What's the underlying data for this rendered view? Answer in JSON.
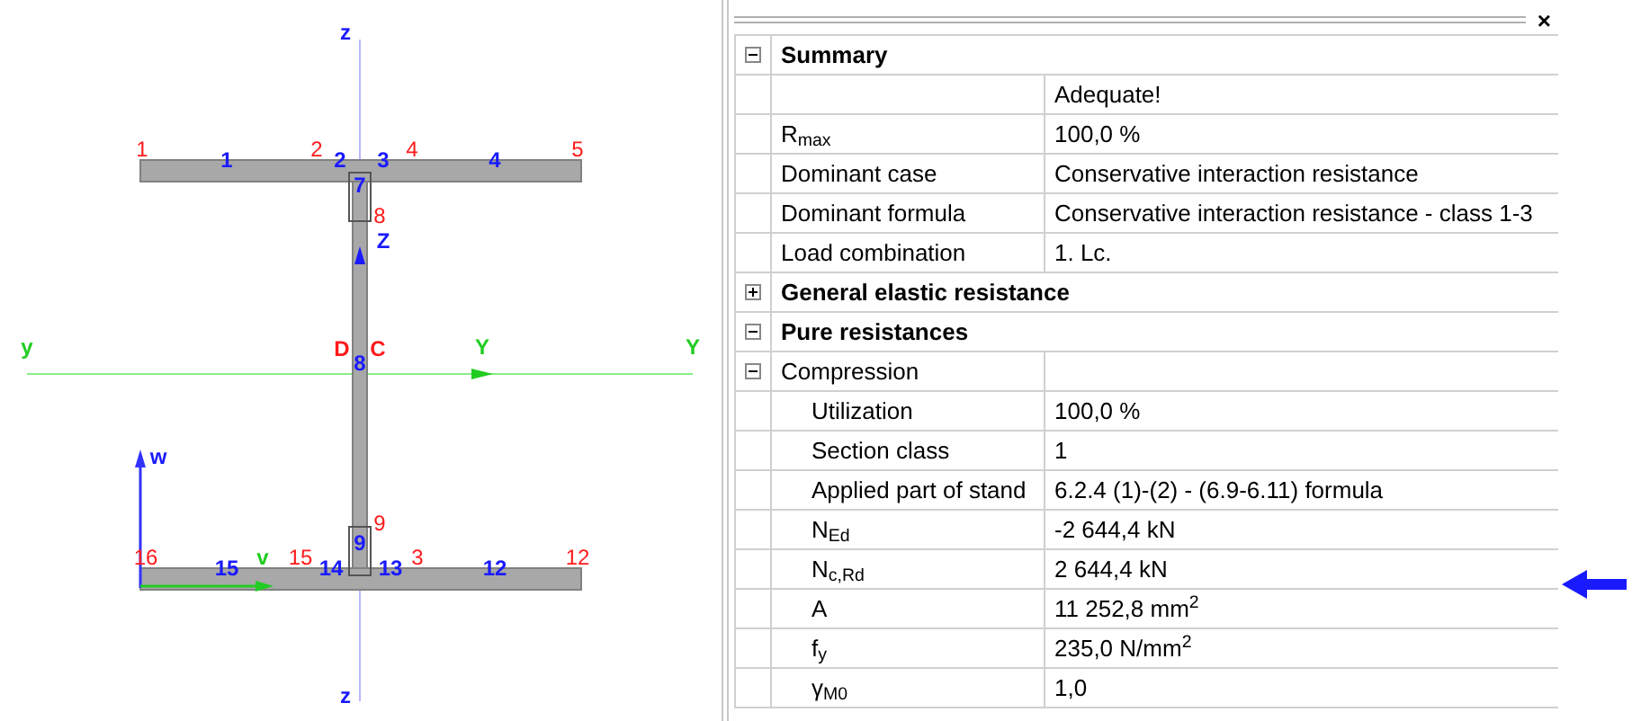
{
  "section_view": {
    "axis_labels": [
      {
        "text": "z",
        "kind": "blue"
      },
      {
        "text": "Z",
        "kind": "blue"
      },
      {
        "text": "y",
        "kind": "green"
      },
      {
        "text": "D",
        "kind": "red"
      },
      {
        "text": "C",
        "kind": "red"
      },
      {
        "text": "Y",
        "kind": "green"
      },
      {
        "text": "Y",
        "kind": "green"
      },
      {
        "text": "w",
        "kind": "blue"
      },
      {
        "text": "v",
        "kind": "green"
      },
      {
        "text": "z",
        "kind": "blue"
      }
    ],
    "node_labels": [
      "1",
      "2",
      "4",
      "5",
      "8",
      "9",
      "16",
      "15",
      "3",
      "12"
    ],
    "segment_labels": [
      "1",
      "2",
      "3",
      "4",
      "7",
      "8",
      "9",
      "15",
      "14",
      "13",
      "12"
    ]
  },
  "properties": {
    "close_glyph": "×",
    "groups": [
      {
        "title": "Summary",
        "expanded": true,
        "children": [
          {
            "kind": "row",
            "value": "Adequate!"
          },
          {
            "kind": "row",
            "label": "R$_{max}$",
            "value": "100,0 %"
          },
          {
            "kind": "row",
            "label": "Dominant case",
            "value": "Conservative interaction resistance"
          },
          {
            "kind": "row",
            "label": "Dominant formula",
            "value": "Conservative interaction resistance - class 1-3"
          },
          {
            "kind": "row",
            "label": "Load combination",
            "value": "1. Lc."
          }
        ]
      },
      {
        "title": "General elastic resistance",
        "expanded": false
      },
      {
        "title": "Pure resistances",
        "expanded": true,
        "children": [
          {
            "kind": "group",
            "label": "Compression",
            "expanded": true,
            "children": [
              {
                "kind": "row",
                "label": "Utilization",
                "value": "100,0 %"
              },
              {
                "kind": "row",
                "label": "Section class",
                "value": "1"
              },
              {
                "kind": "row",
                "label": "Applied part of stand",
                "value": "6.2.4 (1)-(2) - (6.9-6.11) formula"
              },
              {
                "kind": "row",
                "label": "N$_{Ed}$",
                "value": "-2 644,4 kN"
              },
              {
                "kind": "row",
                "label": "N$_{c,Rd}$",
                "value": "2 644,4 kN",
                "pointed": true
              },
              {
                "kind": "row",
                "label": "A",
                "value": "11 252,8 mm$^{2}$"
              },
              {
                "kind": "row",
                "label": "f$_{y}$",
                "value": "235,0 N/mm$^{2}$"
              },
              {
                "kind": "row",
                "label": "γ$_{M0}$",
                "value": "1,0"
              }
            ]
          }
        ]
      }
    ]
  }
}
